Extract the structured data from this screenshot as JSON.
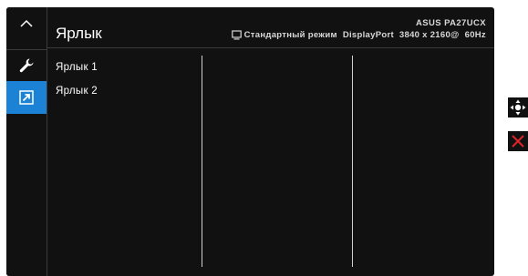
{
  "header": {
    "title": "Ярлык",
    "model": "ASUS PA27UCX",
    "mode": "Стандартный режим",
    "input": "DisplayPort",
    "resolution": "3840 x 2160@",
    "refresh": "60Hz"
  },
  "menu": {
    "items": [
      {
        "label": "Ярлык 1"
      },
      {
        "label": "Ярлык 2"
      }
    ]
  },
  "sidebar": {
    "items": [
      {
        "icon": "chevron-up-icon"
      },
      {
        "icon": "wrench-icon"
      },
      {
        "icon": "shortcut-arrow-icon",
        "active": true
      }
    ]
  },
  "nav": {
    "items": [
      {
        "icon": "joystick-icon"
      },
      {
        "icon": "close-icon"
      }
    ]
  },
  "colors": {
    "accent": "#1c82d6",
    "background": "#111111",
    "close": "#e0242c"
  }
}
